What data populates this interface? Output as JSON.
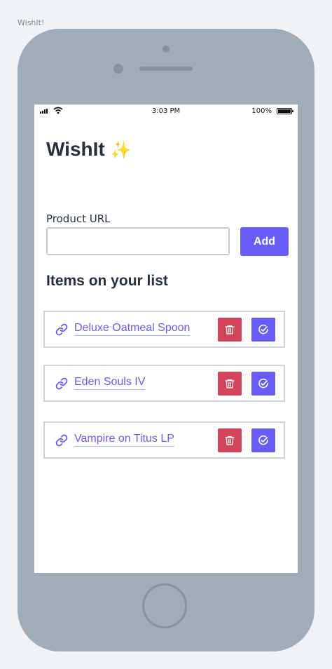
{
  "page_label": "WishIt!",
  "status_bar": {
    "time": "3:03 PM",
    "battery": "100%"
  },
  "app": {
    "title": "WishIt",
    "title_emoji": "✨"
  },
  "form": {
    "url_label": "Product URL",
    "url_value": "",
    "add_label": "Add"
  },
  "list": {
    "heading": "Items on your list",
    "items": [
      {
        "name": "Deluxe Oatmeal Spoon"
      },
      {
        "name": "Eden Souls IV"
      },
      {
        "name": "Vampire on Titus LP"
      }
    ]
  },
  "colors": {
    "accent": "#675cf5",
    "danger": "#d14459",
    "phone_body": "#a0adb8",
    "heading_text": "#25313d"
  },
  "icons": {
    "link": "link-icon",
    "delete": "trash-icon",
    "done": "check-circle-icon"
  }
}
